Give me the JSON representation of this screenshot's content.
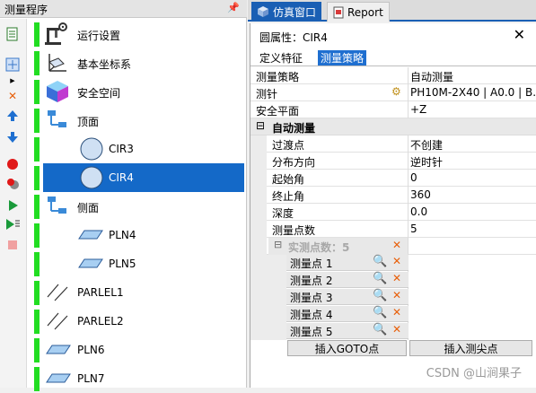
{
  "left_panel": {
    "title": "测量程序",
    "pin_icon": "pushpin",
    "items": [
      {
        "label": "运行设置",
        "icon": "machine-settings-icon"
      },
      {
        "label": "基本坐标系",
        "icon": "coordinate-system-icon"
      },
      {
        "label": "安全空间",
        "icon": "safety-cube-icon"
      },
      {
        "label": "顶面",
        "icon": "feature-group-icon"
      },
      {
        "label": "CIR3",
        "icon": "circle-icon"
      },
      {
        "label": "CIR4",
        "icon": "circle-icon",
        "selected": true
      },
      {
        "label": "侧面",
        "icon": "feature-group-icon"
      },
      {
        "label": "PLN4",
        "icon": "plane-icon"
      },
      {
        "label": "PLN5",
        "icon": "plane-icon"
      },
      {
        "label": "PARLEL1",
        "icon": "parallel-lines-icon"
      },
      {
        "label": "PARLEL2",
        "icon": "parallel-lines-icon"
      },
      {
        "label": "PLN6",
        "icon": "plane-icon"
      },
      {
        "label": "PLN7",
        "icon": "plane-icon"
      }
    ]
  },
  "tabs": [
    {
      "label": "仿真窗口",
      "active": true
    },
    {
      "label": "Report",
      "active": false
    }
  ],
  "property_panel": {
    "title": "圆属性：CIR4",
    "subtabs": [
      {
        "label": "定义特征",
        "active": false
      },
      {
        "label": "测量策略",
        "active": true
      }
    ],
    "rows": [
      {
        "key": "测量策略",
        "value": "自动测量"
      },
      {
        "key": "测针",
        "value": "PH10M-2X40 | A0.0 | B..."
      },
      {
        "key": "安全平面",
        "value": "+Z"
      }
    ],
    "group": {
      "toggle": "⊟",
      "label": "自动测量",
      "rows": [
        {
          "key": "过渡点",
          "value": "不创建"
        },
        {
          "key": "分布方向",
          "value": "逆时针"
        },
        {
          "key": "起始角",
          "value": "0"
        },
        {
          "key": "终止角",
          "value": "360"
        },
        {
          "key": "深度",
          "value": "0.0"
        },
        {
          "key": "测量点数",
          "value": "5"
        }
      ]
    },
    "subgroup": {
      "toggle": "⊟",
      "label": "实测点数：5"
    },
    "points": [
      "测量点 1",
      "测量点 2",
      "测量点 3",
      "测量点 4",
      "测量点 5"
    ],
    "buttons": {
      "insert_goto": "插入GOTO点",
      "insert_tip": "插入测尖点"
    }
  },
  "watermark": "CSDN @山涧果子",
  "colors": {
    "accent": "#1a5fb4",
    "selection": "#1469c8",
    "status_bar": "#22dd22",
    "delete": "#e8600b"
  }
}
